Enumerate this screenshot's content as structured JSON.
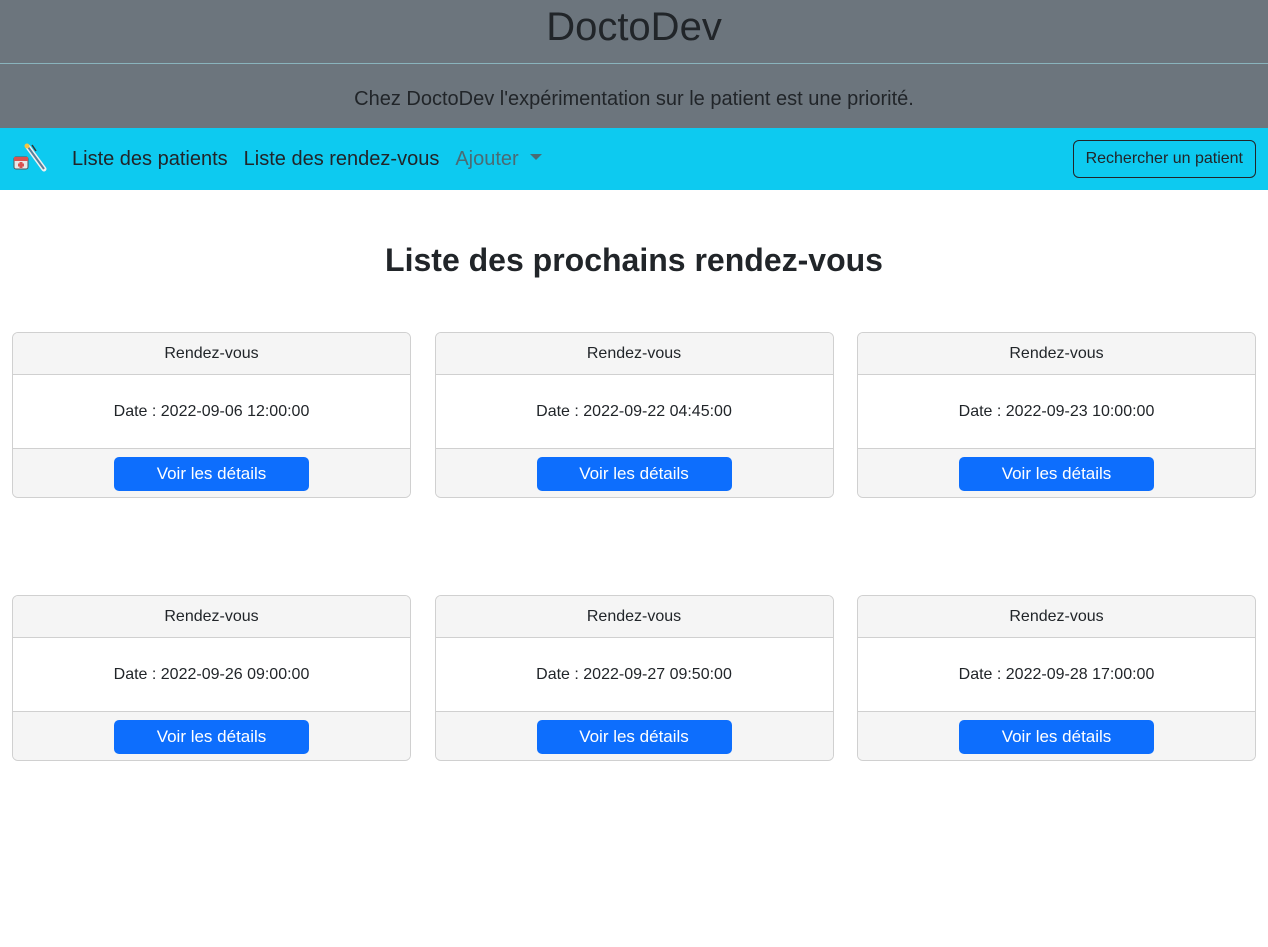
{
  "header": {
    "title": "DoctoDev",
    "tagline": "Chez DoctoDev l'expérimentation sur le patient est une priorité."
  },
  "navbar": {
    "logo_icon": "medical-supplies-icon",
    "links": [
      {
        "label": "Liste des patients"
      },
      {
        "label": "Liste des rendez-vous"
      }
    ],
    "dropdown_label": "Ajouter",
    "search_button_label": "Rechercher un patient",
    "background_color": "#0dcaf0"
  },
  "main": {
    "heading": "Liste des prochains rendez-vous",
    "appointments": [
      {
        "header": "Rendez-vous",
        "date": "Date : 2022-09-06 12:00:00",
        "button": "Voir les détails"
      },
      {
        "header": "Rendez-vous",
        "date": "Date : 2022-09-22 04:45:00",
        "button": "Voir les détails"
      },
      {
        "header": "Rendez-vous",
        "date": "Date : 2022-09-23 10:00:00",
        "button": "Voir les détails"
      },
      {
        "header": "Rendez-vous",
        "date": "Date : 2022-09-26 09:00:00",
        "button": "Voir les détails"
      },
      {
        "header": "Rendez-vous",
        "date": "Date : 2022-09-27 09:50:00",
        "button": "Voir les détails"
      },
      {
        "header": "Rendez-vous",
        "date": "Date : 2022-09-28 17:00:00",
        "button": "Voir les détails"
      }
    ],
    "button_color": "#0d6efd"
  }
}
